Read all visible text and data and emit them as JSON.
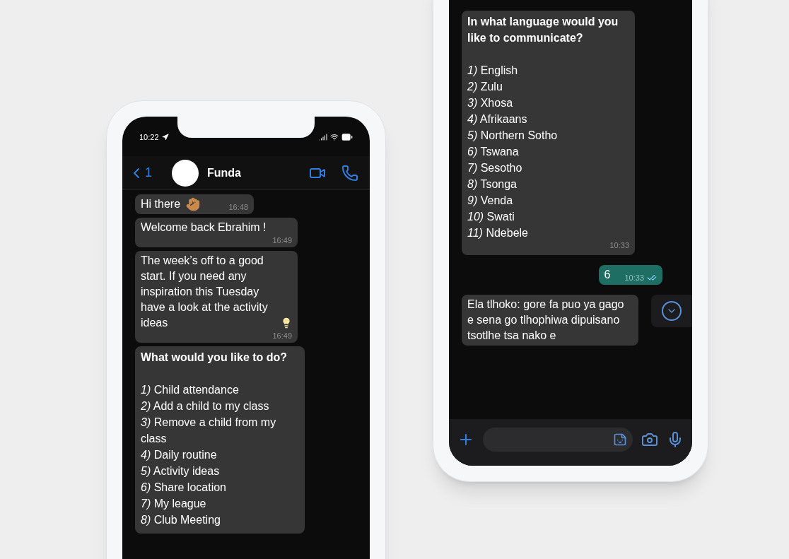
{
  "phones": [
    {
      "status_bar": {
        "time": "10:22"
      },
      "header": {
        "back_count": "1",
        "contact": "Funda"
      },
      "messages": [
        {
          "kind": "text",
          "text": "Hi there",
          "time": "16:48"
        },
        {
          "kind": "text",
          "text": "Welcome back Ebrahim !",
          "time": "16:49"
        },
        {
          "kind": "text",
          "text": "The week’s off to a good start. If you need any inspiration this Tuesday have a look at the activity ideas",
          "time": "16:49"
        },
        {
          "kind": "menu",
          "title": "What would you like to do?",
          "items": [
            {
              "number": "1)",
              "label": "Child attendance"
            },
            {
              "number": "2)",
              "label": "Add a child to my class"
            },
            {
              "number": "3)",
              "label": "Remove a child from my class"
            },
            {
              "number": "4)",
              "label": "Daily routine"
            },
            {
              "number": "5)",
              "label": "Activity ideas"
            },
            {
              "number": "6)",
              "label": "Share location"
            },
            {
              "number": "7)",
              "label": "My league"
            },
            {
              "number": "8)",
              "label": "Club Meeting"
            }
          ]
        }
      ]
    },
    {
      "messages": [
        {
          "kind": "menu",
          "title": "In what language would you like to communicate?",
          "items": [
            {
              "number": "1)",
              "label": "English"
            },
            {
              "number": "2)",
              "label": "Zulu"
            },
            {
              "number": "3)",
              "label": "Xhosa"
            },
            {
              "number": "4)",
              "label": "Afrikaans"
            },
            {
              "number": "5)",
              "label": "Northern Sotho"
            },
            {
              "number": "6)",
              "label": "Tswana"
            },
            {
              "number": "7)",
              "label": "Sesotho"
            },
            {
              "number": "8)",
              "label": "Tsonga"
            },
            {
              "number": "9)",
              "label": "Venda"
            },
            {
              "number": "10)",
              "label": "Swati"
            },
            {
              "number": "11)",
              "label": "Ndebele"
            }
          ],
          "time": "10:33"
        },
        {
          "kind": "sent",
          "text": "6",
          "time": "10:33",
          "read": true
        },
        {
          "kind": "text",
          "text": "Ela tlhoko: gore fa puo ya gago e sena go tlhophiwa dipuisano tsotlhe tsa nako e"
        }
      ],
      "scroll_down_button": true,
      "composer": true
    }
  ]
}
